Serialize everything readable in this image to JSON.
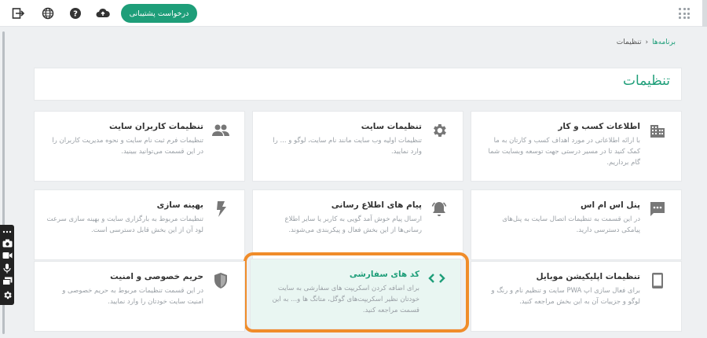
{
  "topbar": {
    "support_label": "درخواست پشتیبانی",
    "icons": [
      "logout-icon",
      "globe-icon",
      "help-icon",
      "cloud-upload-icon",
      "apps-grid-icon"
    ]
  },
  "breadcrumb": {
    "parent": "برنامه‌ها",
    "separator": "›",
    "current": "تنظیمات"
  },
  "page": {
    "title": "تنظیمات"
  },
  "colors": {
    "brand": "#1e9e79",
    "highlight_ring": "#f08c2a",
    "highlight_bg": "#e9f6f2"
  },
  "cards": [
    {
      "title": "اطلاعات کسب و کار",
      "desc": "با ارائه اطلاعاتی در مورد اهداف کسب و کارتان به ما کمک کنید تا در مسیر درستی جهت توسعه وبسایت شما گام برداریم.",
      "icon": "building-icon"
    },
    {
      "title": "تنظیمات سایت",
      "desc": "تنظیمات اولیه وب سایت مانند نام سایت، لوگو و ... را وارد نمایید.",
      "icon": "gear-icon"
    },
    {
      "title": "تنظیمات کاربران سایت",
      "desc": "تنظیمات فرم ثبت نام سایت و نحوه مدیریت کاربران را در این قسمت می‌توانید ببینید.",
      "icon": "users-icon"
    },
    {
      "title": "پنل اس ام اس",
      "desc": "در این قسمت به تنظیمات اتصال سایت به پنل‌های پیامکی دسترسی دارید.",
      "icon": "sms-icon"
    },
    {
      "title": "پیام های اطلاع رسانی",
      "desc": "ارسال پیام خوش آمد گویی به کاربر یا سایر اطلاع رسانی‌ها از این بخش فعال و پیکربندی می‌شوند.",
      "icon": "bell-icon"
    },
    {
      "title": "بهینه سازی",
      "desc": "تنظیمات مربوط به بارگزاری سایت و بهینه سازی سرعت لود آن از این بخش قابل دسترسی است.",
      "icon": "bolt-icon"
    },
    {
      "title": "تنظیمات اپلیکیشن موبایل",
      "desc": "برای فعال سازی اپ PWA سایت و تنظیم نام و رنگ و لوگو و جزییات آن به این بخش مراجعه کنید.",
      "icon": "mobile-icon"
    },
    {
      "title": "کد های سفارشی",
      "desc": "برای اضافه کردن اسکریپت های سفارشی به سایت خودتان نظیر اسکریپت‌های گوگل، متاتگ ها و... به این قسمت مراجعه کنید.",
      "icon": "code-icon"
    },
    {
      "title": "حریم خصوصی و امنیت",
      "desc": "در این قسمت تنظیمات مربوط به حریم خصوصی و امنیت سایت خودتان را وارد نمایید.",
      "icon": "shield-icon"
    }
  ]
}
